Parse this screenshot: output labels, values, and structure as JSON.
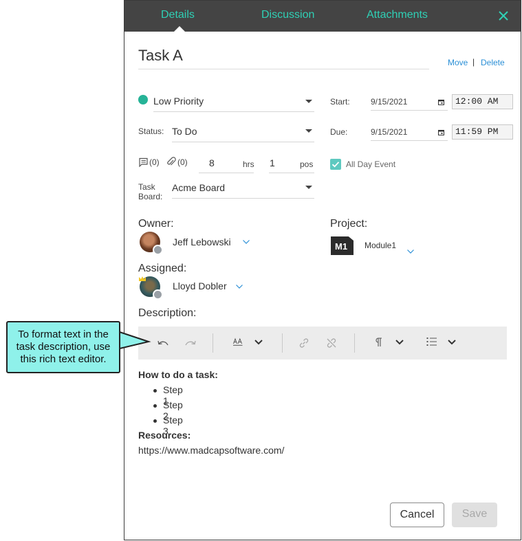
{
  "tabs": [
    {
      "label": "Details"
    },
    {
      "label": "Discussion"
    },
    {
      "label": "Attachments"
    }
  ],
  "task": {
    "title": "Task A",
    "move_label": "Move",
    "separator": "|",
    "delete_label": "Delete"
  },
  "priority": {
    "value": "Low Priority",
    "color": "#26b397"
  },
  "status": {
    "label": "Status:",
    "value": "To Do"
  },
  "counts": {
    "notes": "(0)",
    "attachments": "(0)"
  },
  "estimate": {
    "hours_value": "8",
    "hours_unit": "hrs",
    "positions_value": "1",
    "positions_unit": "pos"
  },
  "task_board": {
    "label": "Task\nBoard:",
    "value": "Acme Board"
  },
  "start": {
    "label": "Start:",
    "date": "9/15/2021",
    "time": "12:00 AM"
  },
  "due": {
    "label": "Due:",
    "date": "9/15/2021",
    "time": "11:59 PM"
  },
  "all_day": {
    "label": "All Day Event",
    "checked": true
  },
  "owner": {
    "label": "Owner:",
    "name": "Jeff Lebowski"
  },
  "project": {
    "label": "Project:",
    "badge": "M1",
    "name": "Module1"
  },
  "assigned": {
    "label": "Assigned:",
    "name": "Lloyd Dobler"
  },
  "description": {
    "label": "Description:",
    "heading": "How to do a task:",
    "steps": [
      "Step 1",
      "Step 2",
      "Step 3"
    ],
    "resources_label": "Resources:",
    "resources_url": "https://www.madcapsoftware.com/"
  },
  "buttons": {
    "cancel": "Cancel",
    "save": "Save"
  },
  "callout": {
    "text": "To format text in the task description, use this rich text editor."
  },
  "colors": {
    "accent": "#2fd1b6",
    "header_bg": "#444444",
    "link": "#2a8fd6",
    "callout_bg": "#8ff1ea"
  }
}
